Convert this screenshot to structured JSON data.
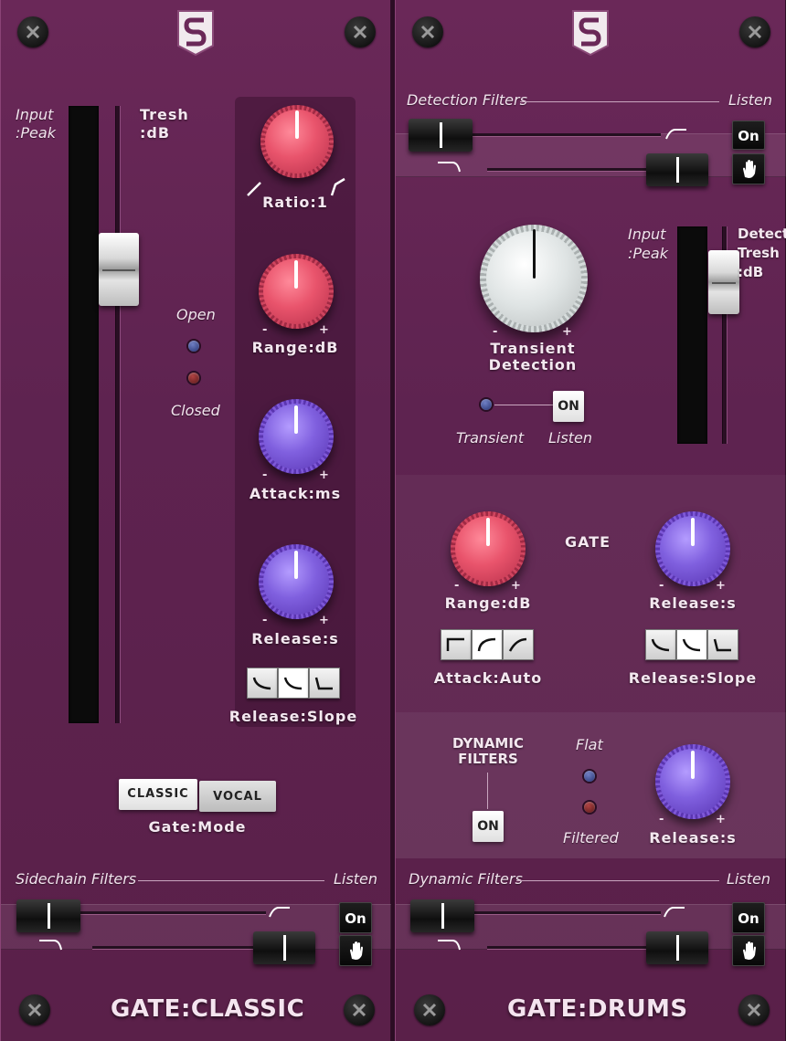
{
  "left": {
    "title": "GATE:CLASSIC",
    "input_label": "Input\n:Peak",
    "tresh_label": "Tresh\n:dB",
    "open_label": "Open",
    "closed_label": "Closed",
    "ratio_label": "Ratio:1",
    "range_label": "Range:dB",
    "attack_label": "Attack:ms",
    "release_label": "Release:s",
    "release_slope_label": "Release:Slope",
    "mode_classic": "CLASSIC",
    "mode_vocal": "VOCAL",
    "mode_label": "Gate:Mode",
    "sidechain_label": "Sidechain Filters",
    "listen_label": "Listen",
    "on_label": "On",
    "minus": "-",
    "plus": "+"
  },
  "right": {
    "title": "GATE:DRUMS",
    "detection_label": "Detection Filters",
    "listen_label": "Listen",
    "on_label": "On",
    "input_label": "Input\n:Peak",
    "detect_tresh_label": "Detect\nTresh\n:dB",
    "transient_detection_label": "Transient\nDetection",
    "transient_label": "Transient",
    "listen2_label": "Listen",
    "on_button": "ON",
    "gate_label": "GATE",
    "range_label": "Range:dB",
    "release_label": "Release:s",
    "attack_auto_label": "Attack:Auto",
    "release_slope_label": "Release:Slope",
    "dynamic_filters_label": "DYNAMIC\nFILTERS",
    "flat_label": "Flat",
    "filtered_label": "Filtered",
    "df_on_button": "ON",
    "df_release_label": "Release:s",
    "dynamic_filters_bottom": "Dynamic Filters",
    "listen3_label": "Listen",
    "on3_label": "On",
    "minus": "-",
    "plus": "+"
  },
  "colors": {
    "panel": "#5e2350",
    "knob_red": "#e9546c",
    "knob_purple": "#8060df",
    "knob_white": "#dfe4e4"
  }
}
